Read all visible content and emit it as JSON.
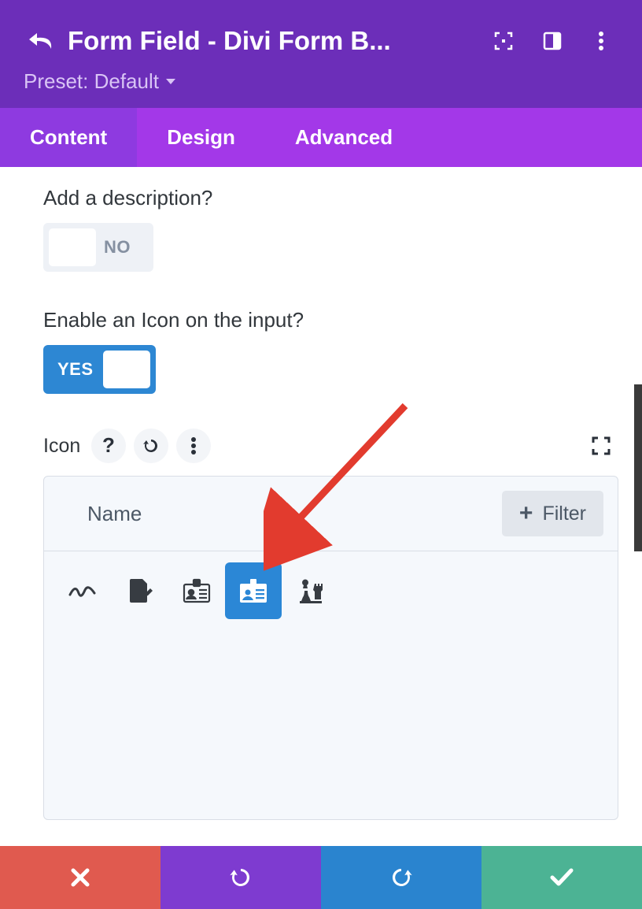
{
  "header": {
    "title": "Form Field - Divi Form B...",
    "preset_label": "Preset: Default"
  },
  "tabs": [
    {
      "label": "Content",
      "active": true
    },
    {
      "label": "Design",
      "active": false
    },
    {
      "label": "Advanced",
      "active": false
    }
  ],
  "fields": {
    "desc_label": "Add a description?",
    "desc_toggle": {
      "state": "off",
      "text": "NO"
    },
    "icon_enable_label": "Enable an Icon on the input?",
    "icon_enable_toggle": {
      "state": "on",
      "text": "YES"
    }
  },
  "icon_section": {
    "label": "Icon",
    "search_placeholder": "Name",
    "filter_label": "Filter"
  },
  "icons": [
    {
      "name": "signature-icon",
      "selected": false
    },
    {
      "name": "file-signature-icon",
      "selected": false
    },
    {
      "name": "id-card-alt-icon",
      "selected": false
    },
    {
      "name": "id-card-icon",
      "selected": true
    },
    {
      "name": "chess-pieces-icon",
      "selected": false
    }
  ],
  "colors": {
    "accent": "#2d87d3",
    "header": "#6c2eb9"
  }
}
